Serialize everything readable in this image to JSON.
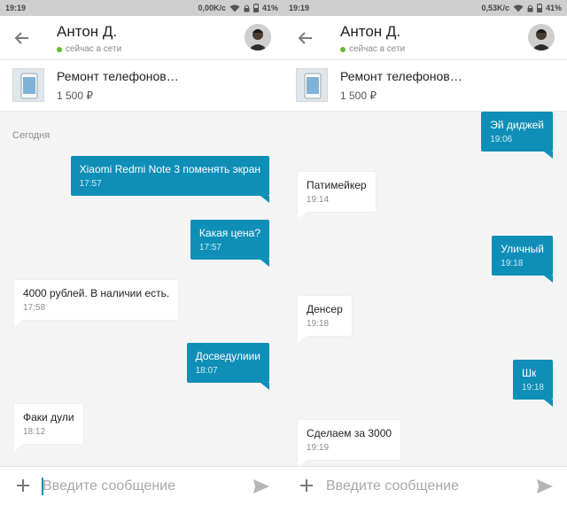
{
  "panels": [
    {
      "status": {
        "time": "19:19",
        "speed": "0,00K/c",
        "battery": "41%"
      },
      "contact": {
        "name": "Антон Д.",
        "status": "сейчас в сети"
      },
      "product": {
        "title": "Ремонт телефонов…",
        "price": "1 500 ₽"
      },
      "day_label": "Сегодня",
      "messages": [
        {
          "text": "Xiaomi Redmi Note 3 поменять экран",
          "time": "17:57"
        },
        {
          "text": "Какая цена?",
          "time": "17:57"
        },
        {
          "text": "4000 рублей. В наличии есть.",
          "time": "17:58"
        },
        {
          "text": "Досведулиии",
          "time": "18:07"
        },
        {
          "text": "Факи дули",
          "time": "18:12"
        }
      ],
      "composer": {
        "placeholder": "Введите сообщение"
      }
    },
    {
      "status": {
        "time": "19:19",
        "speed": "0,53K/c",
        "battery": "41%"
      },
      "contact": {
        "name": "Антон Д.",
        "status": "сейчас в сети"
      },
      "product": {
        "title": "Ремонт телефонов…",
        "price": "1 500 ₽"
      },
      "messages": [
        {
          "text": "Эй диджей",
          "time": "19:06"
        },
        {
          "text": "Патимейкер",
          "time": "19:14"
        },
        {
          "text": "Уличный",
          "time": "19:18"
        },
        {
          "text": "Денсер",
          "time": "19:18"
        },
        {
          "text": "Шк",
          "time": "19:18"
        },
        {
          "text": "Сделаем за 3000",
          "time": "19:19"
        }
      ],
      "composer": {
        "placeholder": "Введите сообщение"
      }
    }
  ],
  "colors": {
    "accent": "#0f8fb8",
    "online": "#5cbf2a",
    "background": "#f4f4f4"
  },
  "icons": [
    "back-arrow-icon",
    "plus-icon",
    "send-icon",
    "wifi-icon",
    "lock-icon",
    "battery-icon",
    "online-dot-icon"
  ]
}
